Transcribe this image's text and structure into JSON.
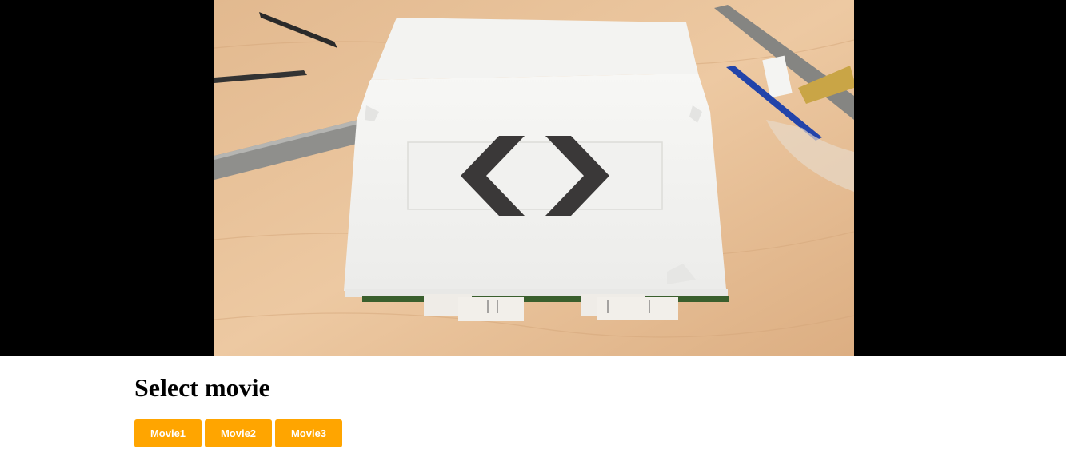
{
  "heading": "Select movie",
  "buttons": [
    {
      "label": "Movie1"
    },
    {
      "label": "Movie2"
    },
    {
      "label": "Movie3"
    }
  ],
  "colors": {
    "button_bg": "#ffa500",
    "button_text": "#ffffff",
    "letterbox": "#000000"
  },
  "video": {
    "icon": "code-brackets-icon"
  }
}
